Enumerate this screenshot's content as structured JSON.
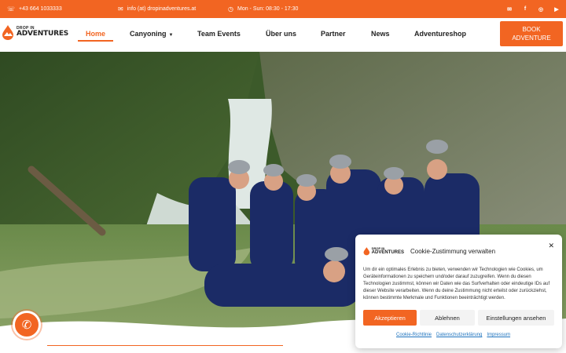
{
  "topbar": {
    "phone": "+43 664 1033333",
    "email": "info (at) dropinadventures.at",
    "hours": "Mon - Sun: 08:30 - 17:30",
    "social_icons": [
      "mail-icon",
      "facebook-icon",
      "instagram-icon",
      "youtube-icon"
    ]
  },
  "logo": {
    "line1": "DROP IN",
    "line2": "ADVENTURES"
  },
  "nav": {
    "items": [
      {
        "label": "Home",
        "active": true
      },
      {
        "label": "Canyoning",
        "has_dropdown": true
      },
      {
        "label": "Team Events"
      },
      {
        "label": "Über uns"
      },
      {
        "label": "Partner"
      },
      {
        "label": "News"
      },
      {
        "label": "Adventureshop"
      }
    ],
    "book_line1": "BOOK",
    "book_line2": "ADVENTURE"
  },
  "cookie": {
    "title": "Cookie-Zustimmung verwalten",
    "text": "Um dir ein optimales Erlebnis zu bieten, verwenden wir Technologien wie Cookies, um Geräteinformationen zu speichern und/oder darauf zuzugreifen. Wenn du diesen Technologien zustimmst, können wir Daten wie das Surfverhalten oder eindeutige IDs auf dieser Website verarbeiten. Wenn du deine Zustimmung nicht erteilst oder zurückziehst, können bestimmte Merkmale und Funktionen beeinträchtigt werden.",
    "accept": "Akzeptieren",
    "deny": "Ablehnen",
    "settings": "Einstellungen ansehen",
    "links": [
      "Cookie-Richtlinie",
      "Datenschutzerklärung",
      "Impressum"
    ]
  },
  "colors": {
    "accent": "#f26522",
    "link": "#1e73be"
  }
}
